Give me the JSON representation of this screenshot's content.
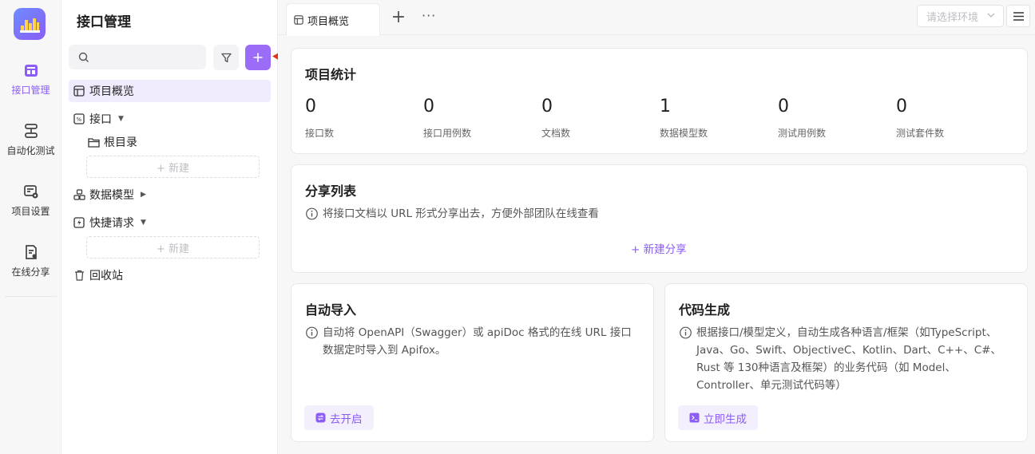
{
  "rail": {
    "items": [
      {
        "label": "接口管理",
        "icon": "api-manage-icon",
        "active": true
      },
      {
        "label": "自动化测试",
        "icon": "automation-test-icon"
      },
      {
        "label": "项目设置",
        "icon": "project-settings-icon"
      },
      {
        "label": "在线分享",
        "icon": "online-share-icon"
      }
    ]
  },
  "tree": {
    "title": "接口管理",
    "search_placeholder": "",
    "items": {
      "overview": "项目概览",
      "api": "接口",
      "root": "根目录",
      "new1": "+ 新建",
      "models": "数据模型",
      "quick": "快捷请求",
      "new2": "+ 新建",
      "trash": "回收站"
    }
  },
  "tabs": {
    "active": "项目概览",
    "add": "+",
    "more": "···"
  },
  "env": {
    "placeholder": "请选择环境"
  },
  "stats": {
    "title": "项目统计",
    "items": [
      {
        "value": "0",
        "label": "接口数"
      },
      {
        "value": "0",
        "label": "接口用例数"
      },
      {
        "value": "0",
        "label": "文档数"
      },
      {
        "value": "1",
        "label": "数据模型数"
      },
      {
        "value": "0",
        "label": "测试用例数"
      },
      {
        "value": "0",
        "label": "测试套件数"
      }
    ]
  },
  "share": {
    "title": "分享列表",
    "desc": "将接口文档以 URL 形式分享出去，方便外部团队在线查看",
    "new_link": "+ 新建分享"
  },
  "import": {
    "title": "自动导入",
    "desc": "自动将 OpenAPI（Swagger）或 apiDoc 格式的在线 URL 接口数据定时导入到 Apifox。",
    "button": "去开启"
  },
  "codegen": {
    "title": "代码生成",
    "desc": "根据接口/模型定义，自动生成各种语言/框架（如TypeScript、Java、Go、Swift、ObjectiveC、Kotlin、Dart、C++、C#、Rust 等 130种语言及框架）的业务代码（如 Model、Controller、单元测试代码等）",
    "button": "立即生成"
  },
  "colors": {
    "accent": "#8b5cf6",
    "add_button": "#9b6cf7",
    "arrow": "#e5331b"
  }
}
